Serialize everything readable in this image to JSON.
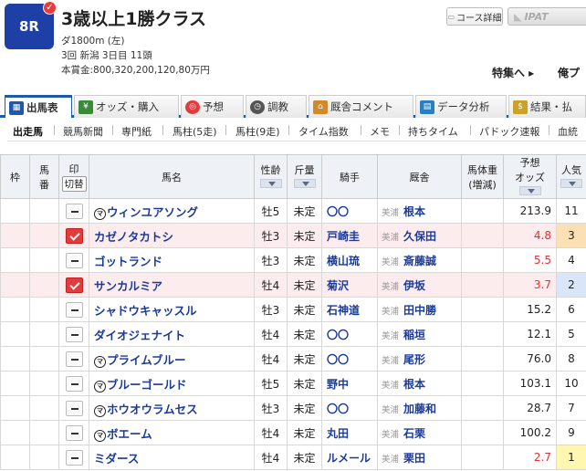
{
  "race": {
    "number": "8R",
    "title": "3歳以上1勝クラス",
    "distance": "ダ1800m (左)",
    "meeting": "3回 新潟 3日目 11頭",
    "prize": "本賞金:800,320,200,120,80万円"
  },
  "header_buttons": {
    "course": "コース詳細",
    "ipat": "IPAT"
  },
  "links": {
    "special": "特集へ ▸",
    "other": "俺プ"
  },
  "tabs": [
    {
      "label": "出馬表",
      "icon": "table-icon"
    },
    {
      "label": "オッズ・購入",
      "icon": "odds-icon"
    },
    {
      "label": "予想",
      "icon": "target-icon"
    },
    {
      "label": "調教",
      "icon": "stopwatch-icon"
    },
    {
      "label": "厩舎コメント",
      "icon": "stable-icon"
    },
    {
      "label": "データ分析",
      "icon": "chart-icon"
    },
    {
      "label": "結果・払",
      "icon": "money-icon"
    }
  ],
  "subnav": [
    "出走馬",
    "競馬新聞",
    "専門紙",
    "馬柱(5走)",
    "馬柱(9走)",
    "タイム指数",
    "メモ",
    "持ちタイム",
    "パドック速報",
    "血統"
  ],
  "columns": {
    "waku": "枠",
    "umaban1": "馬",
    "umaban2": "番",
    "mark": "印",
    "switch": "切替",
    "name": "馬名",
    "age": "性齢",
    "weight": "斤量",
    "jockey": "騎手",
    "stable": "厩舎",
    "bodyweight1": "馬体重",
    "bodyweight2": "(増減)",
    "odds1": "予想",
    "odds2": "オッズ",
    "pop": "人気"
  },
  "horses": [
    {
      "marked": false,
      "maruchi": "マ",
      "name": "ウィンユアソング",
      "age": "牡5",
      "weight": "未定",
      "jockey": "〇〇",
      "region": "美浦",
      "trainer": "根本",
      "odds": "213.9",
      "pop": "11"
    },
    {
      "marked": true,
      "maruchi": "",
      "name": "カゼノタカトシ",
      "age": "牡3",
      "weight": "未定",
      "jockey": "戸崎圭",
      "region": "美浦",
      "trainer": "久保田",
      "odds": "4.8",
      "pop": "3"
    },
    {
      "marked": false,
      "maruchi": "",
      "name": "ゴットランド",
      "age": "牡3",
      "weight": "未定",
      "jockey": "横山琉",
      "region": "美浦",
      "trainer": "斎藤誠",
      "odds": "5.5",
      "pop": "4"
    },
    {
      "marked": true,
      "maruchi": "",
      "name": "サンカルミア",
      "age": "牡4",
      "weight": "未定",
      "jockey": "菊沢",
      "region": "美浦",
      "trainer": "伊坂",
      "odds": "3.7",
      "pop": "2"
    },
    {
      "marked": false,
      "maruchi": "",
      "name": "シャドウキャッスル",
      "age": "牡3",
      "weight": "未定",
      "jockey": "石神道",
      "region": "美浦",
      "trainer": "田中勝",
      "odds": "15.2",
      "pop": "6"
    },
    {
      "marked": false,
      "maruchi": "",
      "name": "ダイオジェナイト",
      "age": "牡4",
      "weight": "未定",
      "jockey": "〇〇",
      "region": "美浦",
      "trainer": "稲垣",
      "odds": "12.1",
      "pop": "5"
    },
    {
      "marked": false,
      "maruchi": "マ",
      "name": "プライムブルー",
      "age": "牡4",
      "weight": "未定",
      "jockey": "〇〇",
      "region": "美浦",
      "trainer": "尾形",
      "odds": "76.0",
      "pop": "8"
    },
    {
      "marked": false,
      "maruchi": "マ",
      "name": "ブルーゴールド",
      "age": "牡5",
      "weight": "未定",
      "jockey": "野中",
      "region": "美浦",
      "trainer": "根本",
      "odds": "103.1",
      "pop": "10"
    },
    {
      "marked": false,
      "maruchi": "マ",
      "name": "ホウオウラムセス",
      "age": "牡3",
      "weight": "未定",
      "jockey": "〇〇",
      "region": "美浦",
      "trainer": "加藤和",
      "odds": "28.7",
      "pop": "7"
    },
    {
      "marked": false,
      "maruchi": "マ",
      "name": "ボエーム",
      "age": "牡4",
      "weight": "未定",
      "jockey": "丸田",
      "region": "美浦",
      "trainer": "石栗",
      "odds": "100.2",
      "pop": "9"
    },
    {
      "marked": false,
      "maruchi": "",
      "name": "ミダース",
      "age": "牡4",
      "weight": "未定",
      "jockey": "ルメール",
      "region": "美浦",
      "trainer": "栗田",
      "odds": "2.7",
      "pop": "1"
    }
  ],
  "colors": {
    "accent": "#1f5aa8",
    "badge": "#1e3fa6",
    "mark_on": "#e23b3b",
    "highlight_row": "#fcecee",
    "pop1": "#fff7b0",
    "pop2": "#d8e6f8",
    "pop3": "#fbe0b6"
  }
}
